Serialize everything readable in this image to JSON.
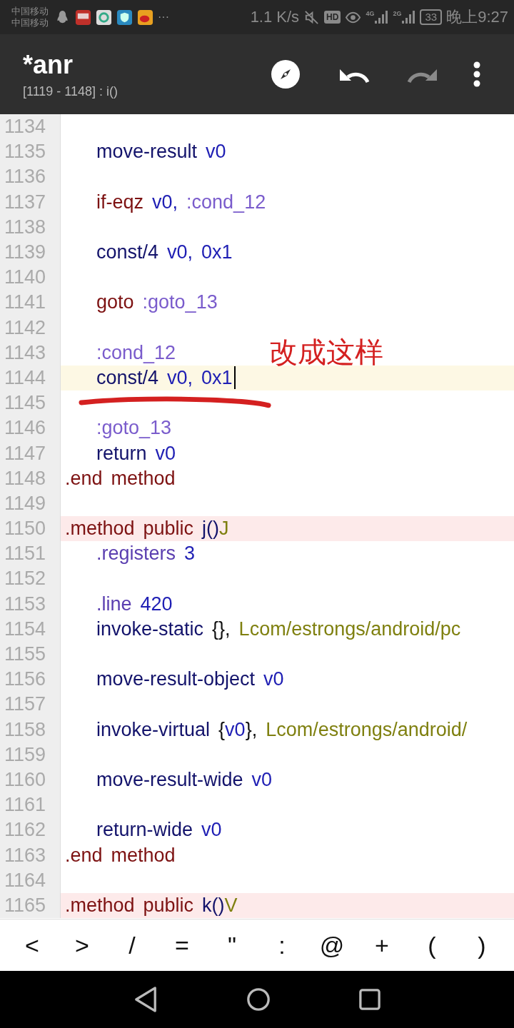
{
  "status_bar": {
    "carriers": [
      "中国移动",
      "中国移动"
    ],
    "more": "···",
    "speed": "1.1 K/s",
    "hd": "HD",
    "signals": [
      {
        "label": "4G"
      },
      {
        "label": "2G"
      }
    ],
    "battery": "33",
    "time": "晚上9:27"
  },
  "app_bar": {
    "title": "*anr",
    "subtitle": "[1119 - 1148] : i()",
    "actions": [
      {
        "kind": "compass",
        "disabled": false
      },
      {
        "kind": "undo",
        "disabled": false
      },
      {
        "kind": "redo",
        "disabled": true
      },
      {
        "kind": "more",
        "disabled": false
      }
    ]
  },
  "editor": {
    "annotation": {
      "text": "改成这样"
    },
    "lines": [
      {
        "number": "1134",
        "kind": "plain",
        "cursor": false
      },
      {
        "number": "1135",
        "kind": "plain",
        "cursor": false,
        "indented": true,
        "words": [
          {
            "text": "move-result",
            "kind": "op"
          },
          {
            "text": "v0",
            "kind": "reg"
          }
        ]
      },
      {
        "number": "1136",
        "kind": "plain",
        "cursor": false
      },
      {
        "number": "1137",
        "kind": "plain",
        "cursor": false,
        "indented": true,
        "words": [
          {
            "text": "if-eqz",
            "kind": "kw"
          },
          {
            "text": "v0,",
            "kind": "reg"
          },
          {
            "text": ":cond_12",
            "kind": "label"
          }
        ]
      },
      {
        "number": "1138",
        "kind": "plain",
        "cursor": false
      },
      {
        "number": "1139",
        "kind": "plain",
        "cursor": false,
        "indented": true,
        "words": [
          {
            "text": "const/4",
            "kind": "op"
          },
          {
            "text": "v0,",
            "kind": "reg"
          },
          {
            "text": "0x1",
            "kind": "num"
          }
        ]
      },
      {
        "number": "1140",
        "kind": "plain",
        "cursor": false
      },
      {
        "number": "1141",
        "kind": "plain",
        "cursor": false,
        "indented": true,
        "words": [
          {
            "text": "goto",
            "kind": "kw"
          },
          {
            "text": ":goto_13",
            "kind": "label"
          }
        ]
      },
      {
        "number": "1142",
        "kind": "plain",
        "cursor": false
      },
      {
        "number": "1143",
        "kind": "plain",
        "cursor": false,
        "indented": true,
        "words": [
          {
            "text": ":cond_12",
            "kind": "label"
          }
        ]
      },
      {
        "number": "1144",
        "kind": "current",
        "cursor": true,
        "indented": true,
        "words": [
          {
            "text": "const/4",
            "kind": "op"
          },
          {
            "text": "v0,",
            "kind": "reg"
          },
          {
            "text": "0x1",
            "kind": "num"
          }
        ]
      },
      {
        "number": "1145",
        "kind": "plain",
        "cursor": false
      },
      {
        "number": "1146",
        "kind": "plain",
        "cursor": false,
        "indented": true,
        "words": [
          {
            "text": ":goto_13",
            "kind": "label"
          }
        ]
      },
      {
        "number": "1147",
        "kind": "plain",
        "cursor": false,
        "indented": true,
        "words": [
          {
            "text": "return",
            "kind": "op"
          },
          {
            "text": "v0",
            "kind": "reg"
          }
        ]
      },
      {
        "number": "1148",
        "kind": "plain",
        "cursor": false,
        "indented": false,
        "words": [
          {
            "text": ".end",
            "kind": "kw"
          },
          {
            "text": "method",
            "kind": "kw"
          }
        ]
      },
      {
        "number": "1149",
        "kind": "plain",
        "cursor": false
      },
      {
        "number": "1150",
        "kind": "method",
        "cursor": false,
        "indented": false,
        "words": [
          {
            "text": ".method",
            "kind": "kw"
          },
          {
            "text": "public",
            "kind": "kw"
          },
          {
            "parts": [
              {
                "text": "j()",
                "kind": "op"
              },
              {
                "text": "J",
                "kind": "cls"
              }
            ]
          }
        ]
      },
      {
        "number": "1151",
        "kind": "plain",
        "cursor": false,
        "indented": true,
        "words": [
          {
            "text": ".registers",
            "kind": "dir"
          },
          {
            "text": "3",
            "kind": "num"
          }
        ]
      },
      {
        "number": "1152",
        "kind": "plain",
        "cursor": false
      },
      {
        "number": "1153",
        "kind": "plain",
        "cursor": false,
        "indented": true,
        "words": [
          {
            "text": ".line",
            "kind": "dir"
          },
          {
            "text": "420",
            "kind": "num"
          }
        ]
      },
      {
        "number": "1154",
        "kind": "plain",
        "cursor": false,
        "indented": true,
        "words": [
          {
            "text": "invoke-static",
            "kind": "op"
          },
          {
            "text": "{},",
            "kind": "punct"
          },
          {
            "text": "Lcom/estrongs/android/pc",
            "kind": "cls"
          }
        ]
      },
      {
        "number": "1155",
        "kind": "plain",
        "cursor": false
      },
      {
        "number": "1156",
        "kind": "plain",
        "cursor": false,
        "indented": true,
        "words": [
          {
            "text": "move-result-object",
            "kind": "op"
          },
          {
            "text": "v0",
            "kind": "reg"
          }
        ]
      },
      {
        "number": "1157",
        "kind": "plain",
        "cursor": false
      },
      {
        "number": "1158",
        "kind": "plain",
        "cursor": false,
        "indented": true,
        "words": [
          {
            "text": "invoke-virtual",
            "kind": "op"
          },
          {
            "parts": [
              {
                "text": "{",
                "kind": "punct"
              },
              {
                "text": "v0",
                "kind": "reg"
              },
              {
                "text": "},",
                "kind": "punct"
              }
            ]
          },
          {
            "text": "Lcom/estrongs/android/",
            "kind": "cls"
          }
        ]
      },
      {
        "number": "1159",
        "kind": "plain",
        "cursor": false
      },
      {
        "number": "1160",
        "kind": "plain",
        "cursor": false,
        "indented": true,
        "words": [
          {
            "text": "move-result-wide",
            "kind": "op"
          },
          {
            "text": "v0",
            "kind": "reg"
          }
        ]
      },
      {
        "number": "1161",
        "kind": "plain",
        "cursor": false
      },
      {
        "number": "1162",
        "kind": "plain",
        "cursor": false,
        "indented": true,
        "words": [
          {
            "text": "return-wide",
            "kind": "op"
          },
          {
            "text": "v0",
            "kind": "reg"
          }
        ]
      },
      {
        "number": "1163",
        "kind": "plain",
        "cursor": false,
        "indented": false,
        "words": [
          {
            "text": ".end",
            "kind": "kw"
          },
          {
            "text": "method",
            "kind": "kw"
          }
        ]
      },
      {
        "number": "1164",
        "kind": "plain",
        "cursor": false
      },
      {
        "number": "1165",
        "kind": "method",
        "cursor": false,
        "indented": false,
        "words": [
          {
            "text": ".method",
            "kind": "kw"
          },
          {
            "text": "public",
            "kind": "kw"
          },
          {
            "parts": [
              {
                "text": "k()",
                "kind": "op"
              },
              {
                "text": "V",
                "kind": "cls"
              }
            ]
          }
        ]
      }
    ]
  },
  "symbol_keys": [
    "<",
    ">",
    "/",
    "=",
    "\"",
    ":",
    "@",
    "+",
    "(",
    ")"
  ]
}
